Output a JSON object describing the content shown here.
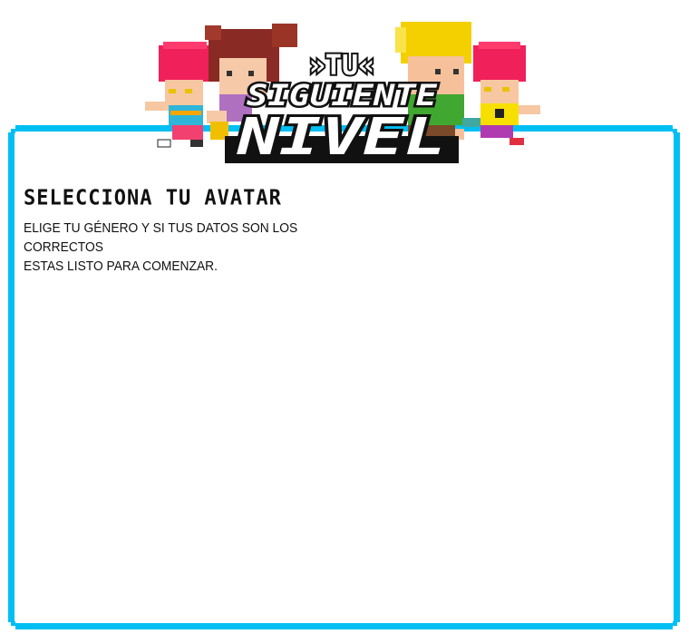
{
  "logo": {
    "line1": "»TU«",
    "line2": "SIGUIENTE",
    "line3": "NIVEL"
  },
  "panel": {
    "title": "SELECCIONA TU AVATAR",
    "description_line1": "ELIGE TU GÉNERO Y SI TUS DATOS SON LOS CORRECTOS",
    "description_line2": "ESTAS LISTO PARA COMENZAR."
  },
  "colors": {
    "frame": "#00bff3",
    "logo_fill": "#ffffff",
    "logo_outline": "#111111"
  }
}
